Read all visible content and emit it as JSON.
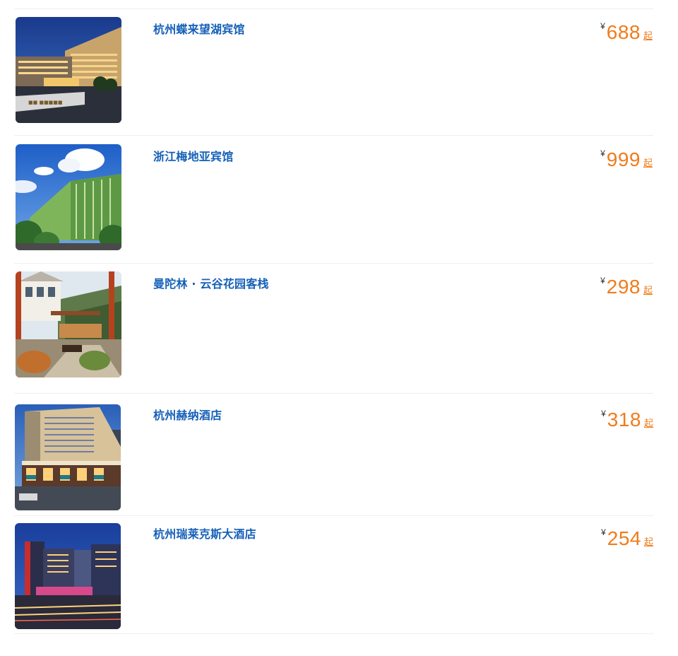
{
  "currency_symbol": "¥",
  "price_suffix": "起",
  "hotels": [
    {
      "name": "杭州蝶来望湖宾馆",
      "price": "688",
      "image": "hotel-exterior-night"
    },
    {
      "name": "浙江梅地亚宾馆",
      "price": "999",
      "image": "hotel-tower-blue-sky"
    },
    {
      "name": "曼陀林 · 云谷花园客栈",
      "price": "298",
      "image": "garden-inn-courtyard"
    },
    {
      "name": "杭州赫纳酒店",
      "price": "318",
      "image": "hotel-corner-dusk"
    },
    {
      "name": "杭州瑞莱克斯大酒店",
      "price": "254",
      "image": "hotel-city-night"
    }
  ]
}
